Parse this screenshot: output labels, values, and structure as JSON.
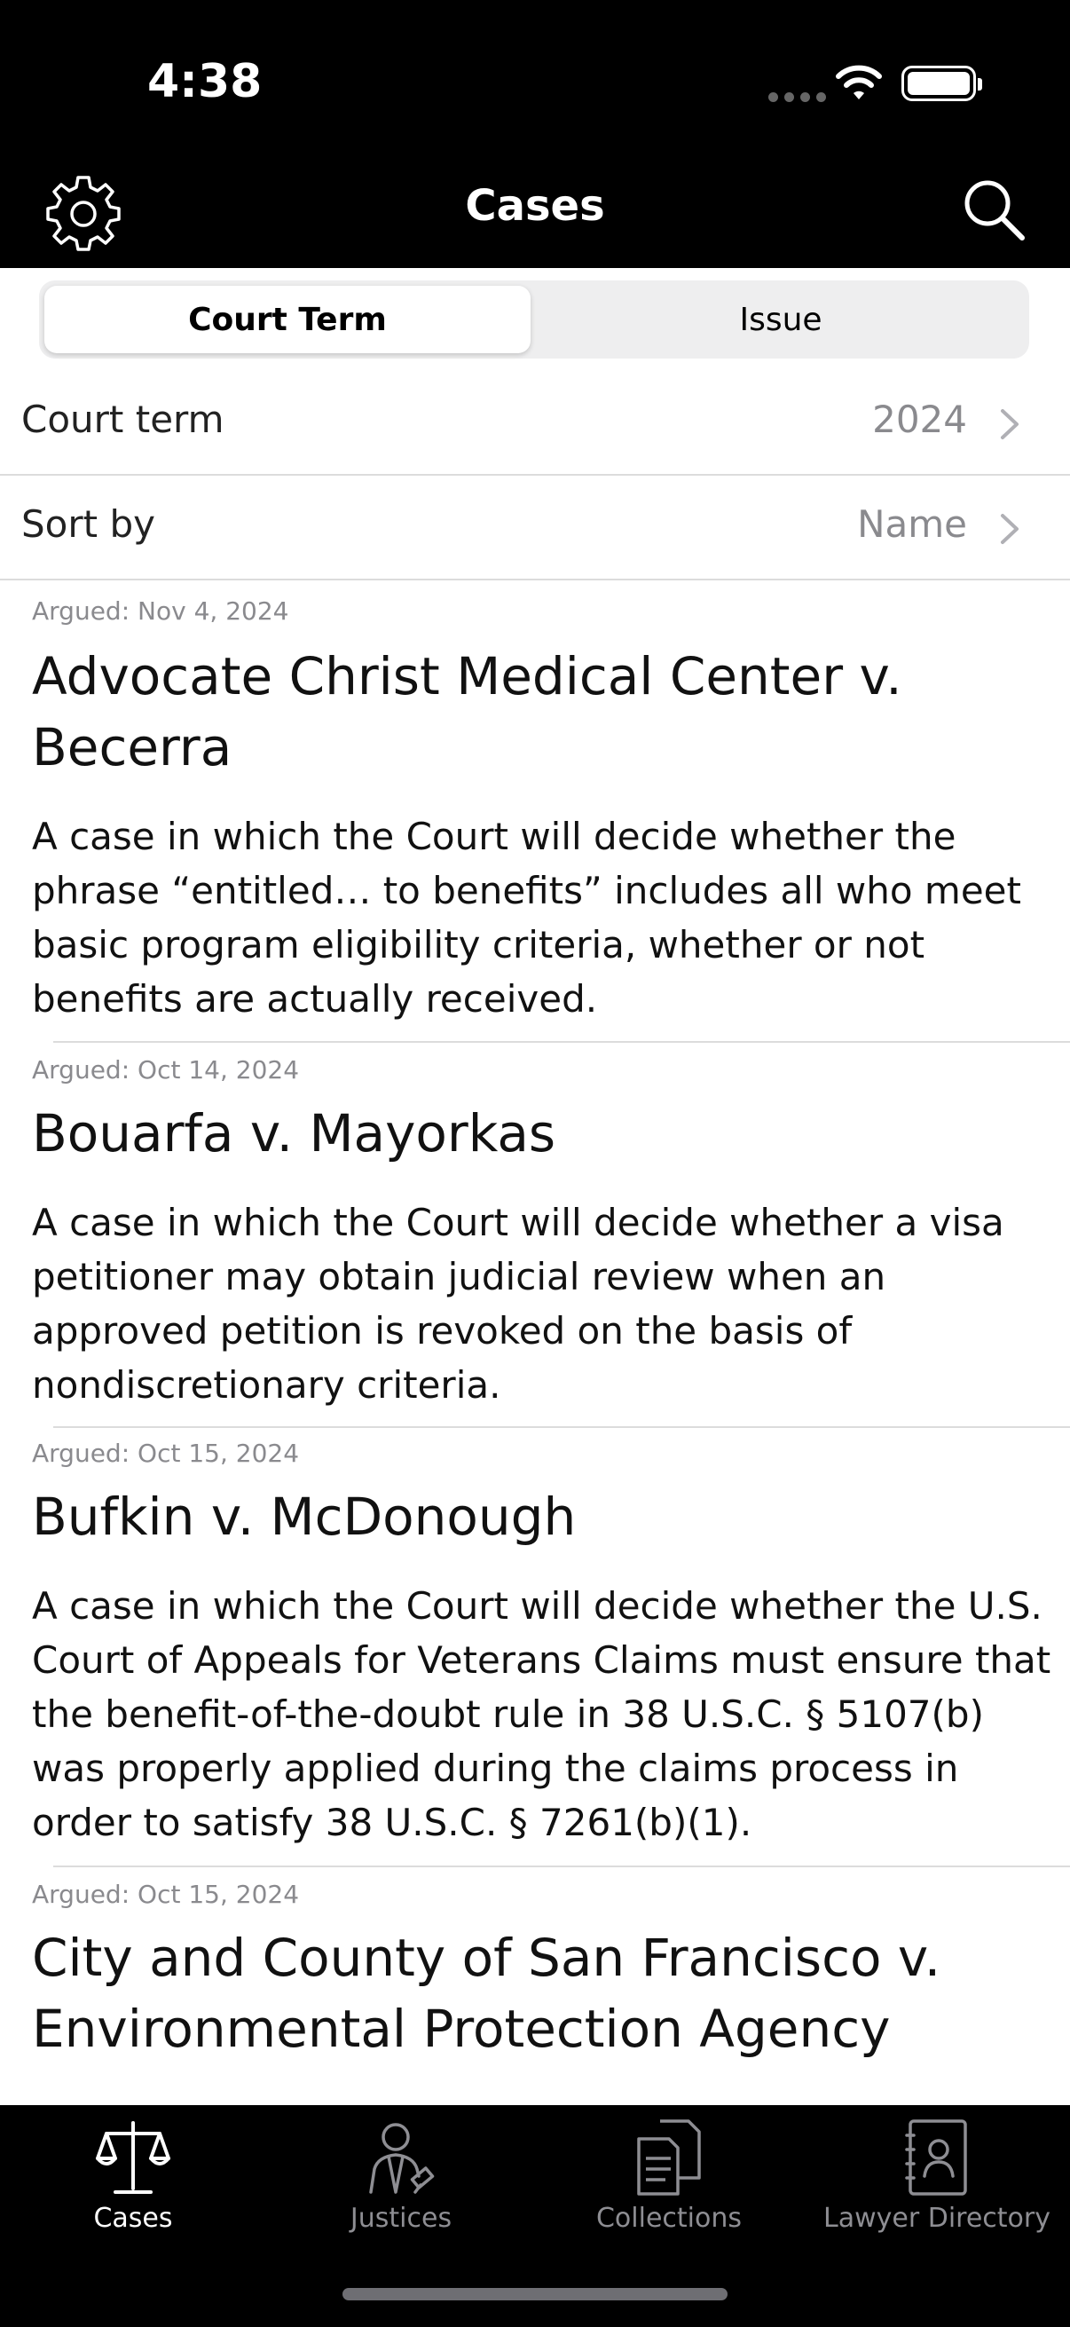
{
  "status_bar": {
    "time": "4:38"
  },
  "nav": {
    "title": "Cases",
    "settings_icon": "gear-icon",
    "search_icon": "search-icon"
  },
  "segmented": {
    "options": [
      "Court Term",
      "Issue"
    ],
    "selected": "Court Term"
  },
  "filters": {
    "court_term": {
      "label": "Court term",
      "value": "2024"
    },
    "sort_by": {
      "label": "Sort by",
      "value": "Name"
    }
  },
  "cases": [
    {
      "argued": "Argued: Nov 4, 2024",
      "title": "Advocate Christ Medical Center v. Becerra",
      "description": "A case in which the Court will decide whether the phrase “entitled… to benefits” includes all who meet basic program eligibility criteria, whether or not benefits are actually received."
    },
    {
      "argued": "Argued: Oct 14, 2024",
      "title": "Bouarfa v. Mayorkas",
      "description": "A case in which the Court will decide whether a visa petitioner may obtain judicial review when an approved petition is revoked on the basis of nondiscretionary criteria."
    },
    {
      "argued": "Argued: Oct 15, 2024",
      "title": "Bufkin v. McDonough",
      "description": "A case in which the Court will decide whether the U.S. Court of Appeals for Veterans Claims must ensure that the benefit-of-the-doubt rule in 38 U.S.C. § 5107(b) was properly applied during the claims process in order to satisfy 38 U.S.C. § 7261(b)(1)."
    },
    {
      "argued": "Argued: Oct 15, 2024",
      "title": "City and County of San Francisco v. Environmental Protection Agency",
      "description": ""
    }
  ],
  "tabbar": {
    "items": [
      {
        "label": "Cases",
        "icon": "scales-icon",
        "active": true
      },
      {
        "label": "Justices",
        "icon": "justice-icon",
        "active": false
      },
      {
        "label": "Collections",
        "icon": "documents-icon",
        "active": false
      },
      {
        "label": "Lawyer Directory",
        "icon": "directory-icon",
        "active": false
      }
    ]
  },
  "colors": {
    "bar_background": "#000000",
    "secondary_text": "#8a8a8e",
    "separator": "#dcdcdc"
  }
}
